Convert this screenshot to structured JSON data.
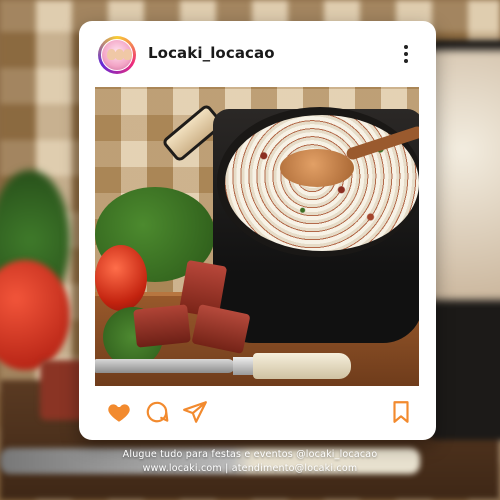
{
  "post": {
    "username": "Locaki_locacao",
    "photo_description": ""
  },
  "icons": {
    "more": "more-vertical-icon",
    "like": "heart-icon",
    "comment": "comment-icon",
    "share": "send-icon",
    "save": "bookmark-icon"
  },
  "colors": {
    "accent": "#f28a2e",
    "card": "#ffffff",
    "text": "#1a1a1a"
  },
  "caption": {
    "line1": "Alugue tudo para festas e eventos @locaki_locacao",
    "line2": "www.locaki.com | atendimento@locaki.com"
  }
}
